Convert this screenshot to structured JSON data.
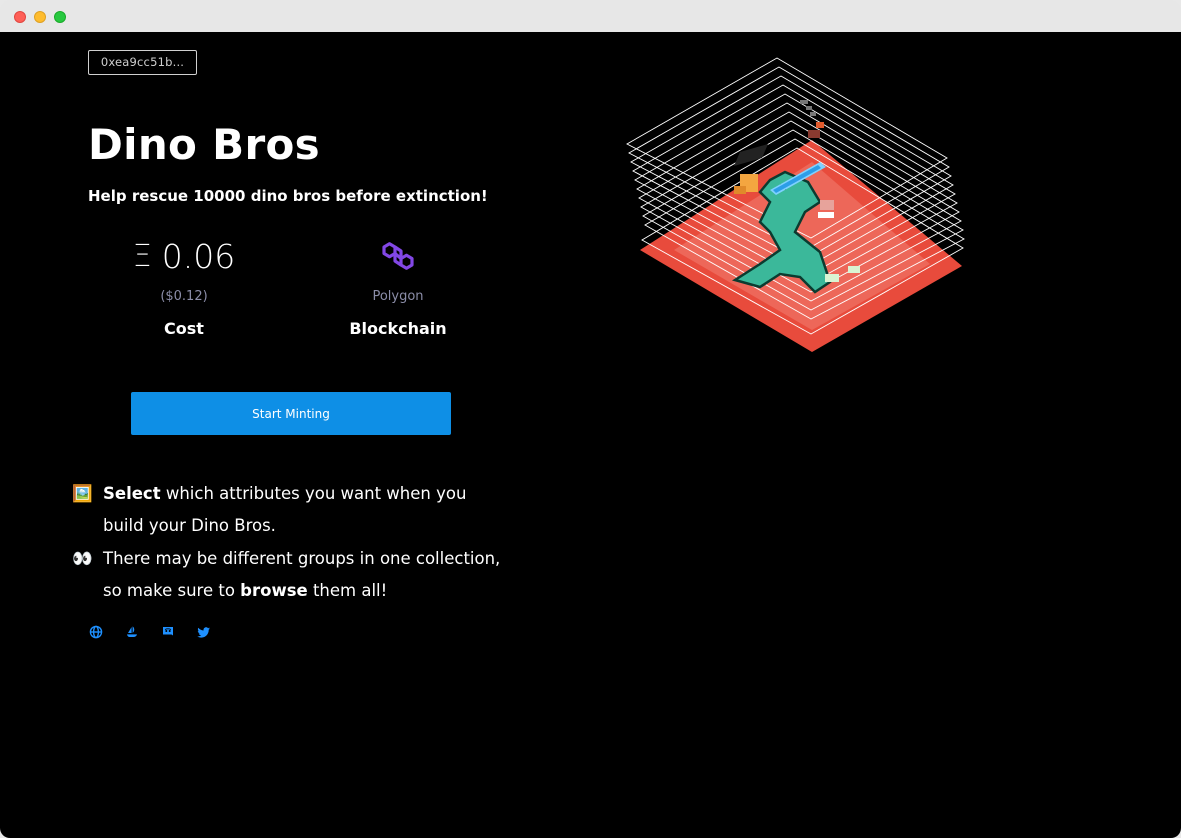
{
  "header": {
    "wallet_address": "0xea9cc51b..."
  },
  "collection": {
    "title": "Dino Bros",
    "subtitle": "Help rescue 10000 dino bros before extinction!"
  },
  "stats": {
    "cost": {
      "symbol": "Ξ",
      "value": "0.06",
      "usd": "($0.12)",
      "label": "Cost"
    },
    "blockchain": {
      "icon": "polygon-icon",
      "value": "Polygon",
      "label": "Blockchain"
    }
  },
  "actions": {
    "mint_label": "Start Minting"
  },
  "info": {
    "line1": {
      "emoji": "🖼️",
      "bold": "Select",
      "rest": " which attributes you want when you build your Dino Bros."
    },
    "line2": {
      "emoji": "👀",
      "pre": "There may be different groups in one collection, so make sure to ",
      "bold": "browse",
      "post": " them all!"
    }
  },
  "socials": [
    {
      "icon": "globe-icon"
    },
    {
      "icon": "opensea-icon"
    },
    {
      "icon": "discord-icon"
    },
    {
      "icon": "twitter-icon"
    }
  ],
  "colors": {
    "background": "#000000",
    "accent_button": "#0e8fe6",
    "muted_text": "#8b8da8",
    "polygon_purple": "#8247e5",
    "social_blue": "#1e90ff",
    "art_base": "#e84b3c",
    "dino_teal": "#3bb89a"
  }
}
